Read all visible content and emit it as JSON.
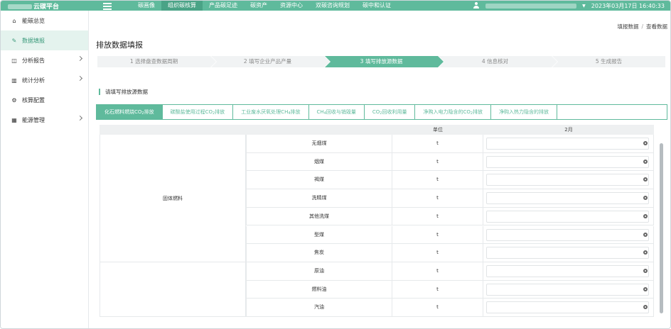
{
  "topbar": {
    "brand": "云碳平台",
    "nav": [
      "碳画像",
      "组织碳核算",
      "产品碳足迹",
      "碳资产",
      "资源中心",
      "双碳咨询规划",
      "碳中和认证"
    ],
    "active_nav_index": 1,
    "datetime": "2023年03月17日  16:40:33",
    "accent_color": "#5fba9c"
  },
  "sidebar": {
    "items": [
      {
        "label": "能碳总览",
        "icon": "home-icon",
        "glyph": "⌂",
        "expandable": false,
        "active": false
      },
      {
        "label": "数据填报",
        "icon": "edit-icon",
        "glyph": "✎",
        "expandable": false,
        "active": true
      },
      {
        "label": "分析报告",
        "icon": "book-icon",
        "glyph": "◫",
        "expandable": true,
        "active": false
      },
      {
        "label": "统计分析",
        "icon": "bar-chart-icon",
        "glyph": "▥",
        "expandable": true,
        "active": false
      },
      {
        "label": "核算配置",
        "icon": "gears-icon",
        "glyph": "⚙",
        "expandable": false,
        "active": false
      },
      {
        "label": "能源管理",
        "icon": "map-icon",
        "glyph": "▦",
        "expandable": true,
        "active": false
      }
    ]
  },
  "breadcrumb": {
    "parent": "填报数据",
    "separator": "/",
    "current": "查看数据"
  },
  "page": {
    "title": "排放数据填报"
  },
  "steps": [
    {
      "label": "1 选择盘查数据周期",
      "active": false
    },
    {
      "label": "2 填写企业产品产量",
      "active": false
    },
    {
      "label": "3 填写排放源数据",
      "active": true
    },
    {
      "label": "4 信息核对",
      "active": false
    },
    {
      "label": "5 生成报告",
      "active": false
    }
  ],
  "section": {
    "title": "请填写排放源数据"
  },
  "tabs": [
    {
      "pre": "化石燃料燃烧CO",
      "sub": "2",
      "post": "排放",
      "active": true
    },
    {
      "pre": "碳酸盐使用过程CO",
      "sub": "2",
      "post": "排放",
      "active": false
    },
    {
      "pre": "工业废水厌氧处理CH",
      "sub": "4",
      "post": "排放",
      "active": false
    },
    {
      "pre": "CH",
      "sub": "4",
      "post": "回收与销毁量",
      "active": false
    },
    {
      "pre": "CO",
      "sub": "2",
      "post": "回收利用量",
      "active": false
    },
    {
      "pre": "净购入电力隐含的CO",
      "sub": "2",
      "post": "排放",
      "active": false
    },
    {
      "pre": "净购入热力隐含的排放",
      "sub": "",
      "post": "",
      "active": false
    }
  ],
  "table": {
    "headers": {
      "category": "",
      "name": "",
      "unit": "单位",
      "value": "2月"
    },
    "groups": [
      {
        "label": "固体燃料",
        "rows": [
          {
            "name": "无烟煤",
            "unit": "t",
            "value": ""
          },
          {
            "name": "烟煤",
            "unit": "t",
            "value": ""
          },
          {
            "name": "褐煤",
            "unit": "t",
            "value": ""
          },
          {
            "name": "洗精煤",
            "unit": "t",
            "value": ""
          },
          {
            "name": "其他洗煤",
            "unit": "t",
            "value": ""
          },
          {
            "name": "型煤",
            "unit": "t",
            "value": ""
          },
          {
            "name": "焦炭",
            "unit": "t",
            "value": ""
          }
        ]
      },
      {
        "label": "",
        "rows": [
          {
            "name": "原油",
            "unit": "t",
            "value": ""
          },
          {
            "name": "燃料油",
            "unit": "t",
            "value": ""
          },
          {
            "name": "汽油",
            "unit": "t",
            "value": ""
          }
        ]
      }
    ]
  }
}
